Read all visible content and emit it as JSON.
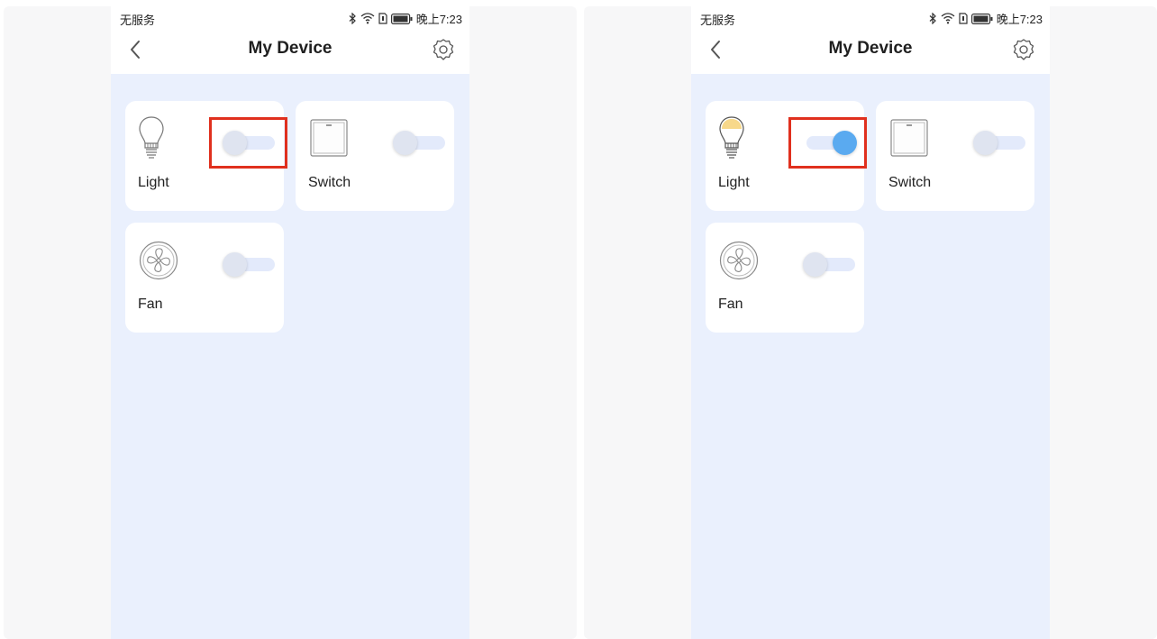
{
  "status_bar": {
    "carrier": "无服务",
    "time": "晚上7:23",
    "icons": [
      "bluetooth-icon",
      "wifi-icon",
      "sim-icon",
      "battery-icon"
    ]
  },
  "header": {
    "title": "My Device",
    "back_icon": "chevron-left-icon",
    "settings_icon": "gear-icon"
  },
  "before": {
    "devices": [
      {
        "label": "Light",
        "icon": "bulb-icon",
        "on": false
      },
      {
        "label": "Switch",
        "icon": "wall-switch-icon",
        "on": false
      },
      {
        "label": "Fan",
        "icon": "fan-icon",
        "on": false
      }
    ]
  },
  "after": {
    "devices": [
      {
        "label": "Light",
        "icon": "bulb-icon",
        "on": true
      },
      {
        "label": "Switch",
        "icon": "wall-switch-icon",
        "on": false
      },
      {
        "label": "Fan",
        "icon": "fan-icon",
        "on": false
      }
    ]
  },
  "colors": {
    "background": "#eaf0fd",
    "toggle_on": "#5aaaf0",
    "toggle_off": "#dfe4f0",
    "highlight": "#e0301e",
    "bulb_lit": "#f7d88a"
  }
}
